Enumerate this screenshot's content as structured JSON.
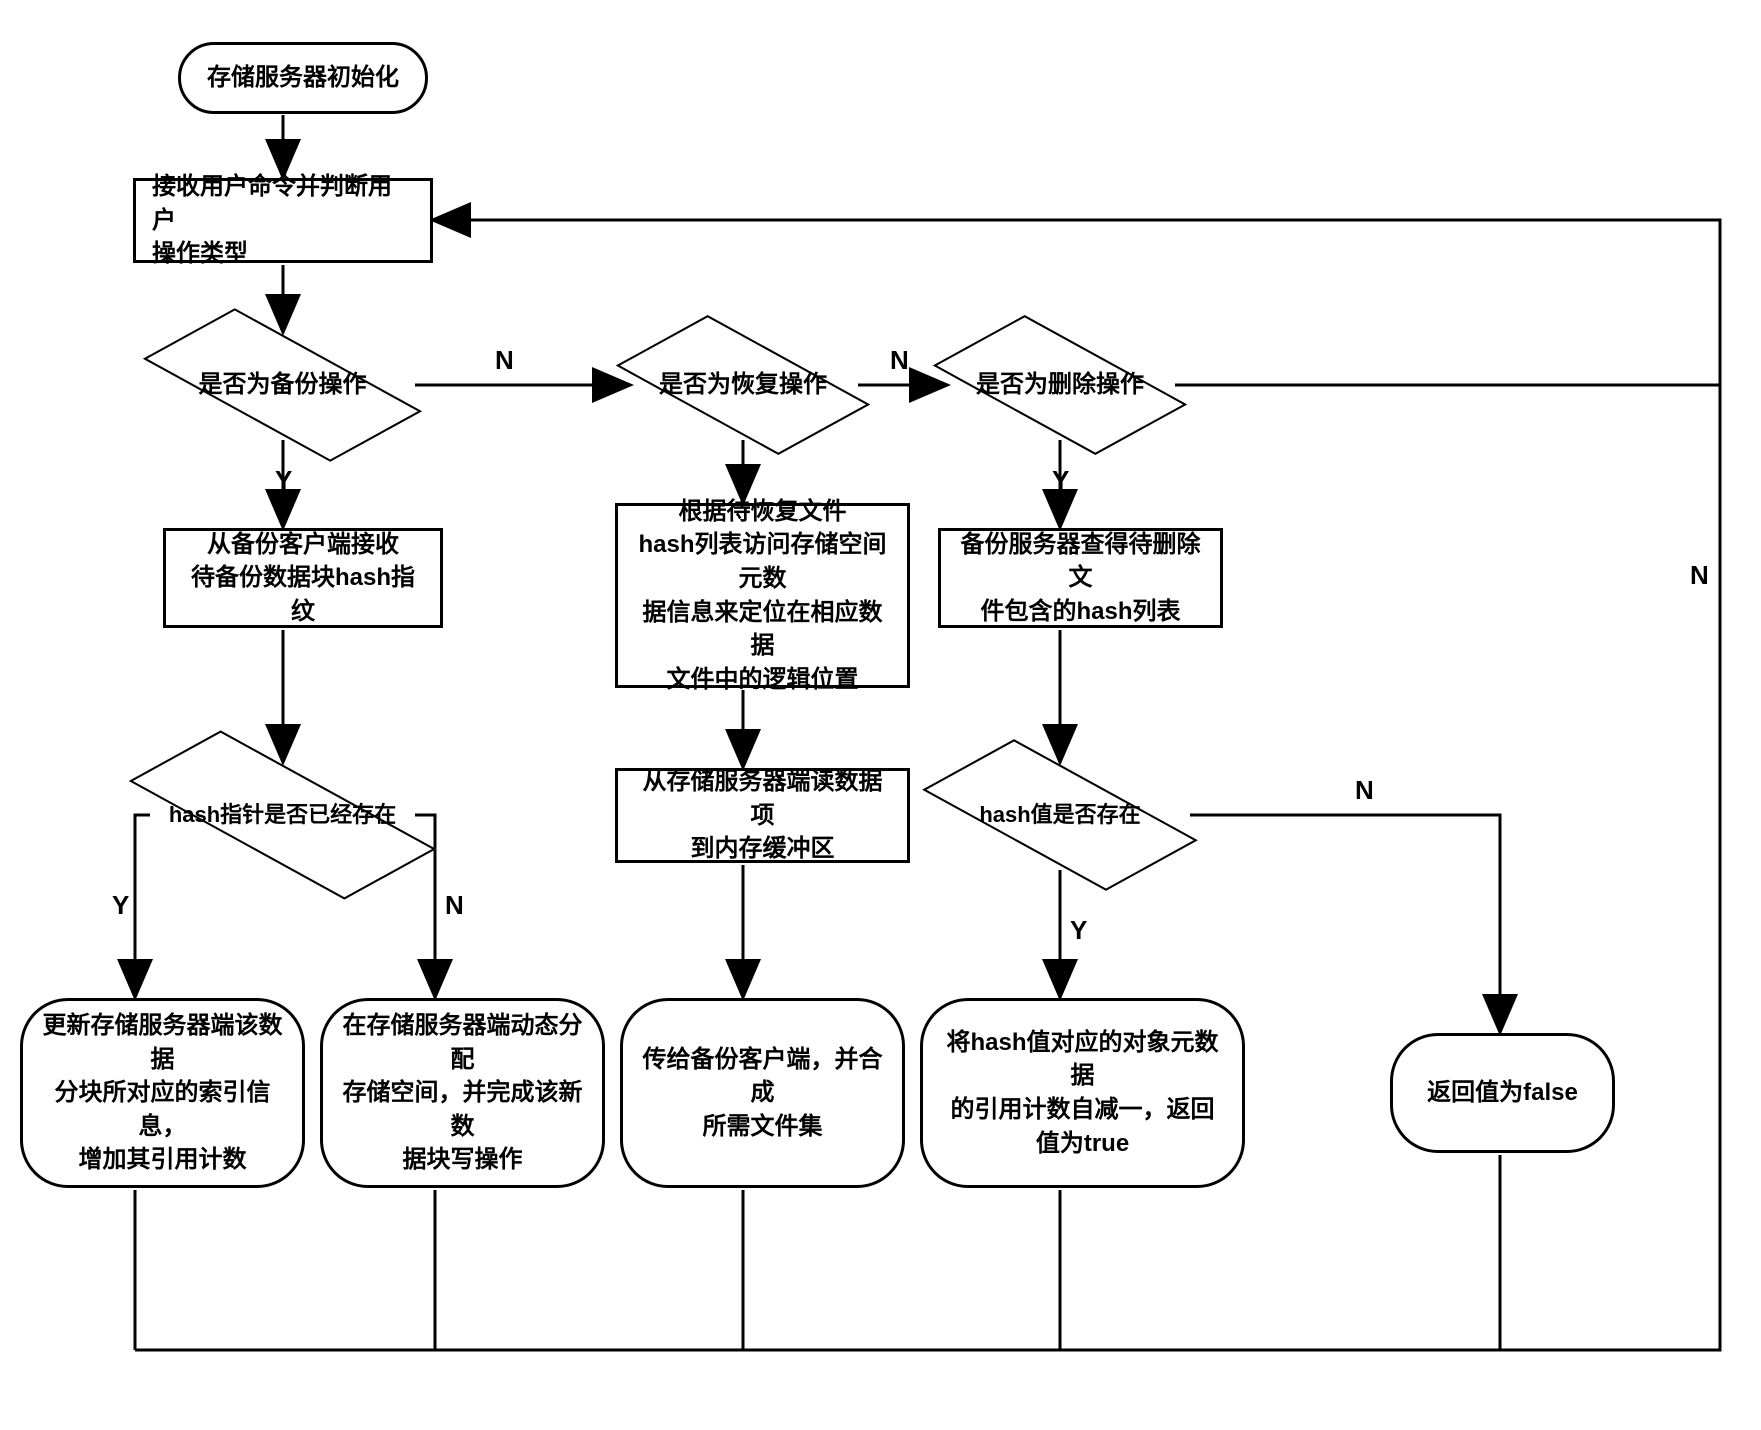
{
  "nodes": {
    "start": "存储服务器初始化",
    "recv": "接收用户命令并判断用户\n操作类型",
    "d_backup": "是否为备份操作",
    "d_restore": "是否为恢复操作",
    "d_delete": "是否为删除操作",
    "p_backup1": "从备份客户端接收\n待备份数据块hash指纹",
    "d_hashptr": "hash指针是否已经存在",
    "t_update": "更新存储服务器端该数据\n分块所对应的索引信息，\n增加其引用计数",
    "t_alloc": "在存储服务器端动态分配\n存储空间，并完成该新数\n据块写操作",
    "p_restore1": "根据待恢复文件\nhash列表访问存储空间元数\n据信息来定位在相应数据\n文件中的逻辑位置",
    "p_restore2": "从存储服务器端读数据项\n到内存缓冲区",
    "t_restore3": "传给备份客户端，并合成\n所需文件集",
    "p_delete1": "备份服务器查得待删除文\n件包含的hash列表",
    "d_hashval": "hash值是否存在",
    "t_dec": "将hash值对应的对象元数据\n的引用计数自减一，返回\n值为true",
    "t_false": "返回值为false"
  },
  "labels": {
    "Y": "Y",
    "N": "N"
  }
}
